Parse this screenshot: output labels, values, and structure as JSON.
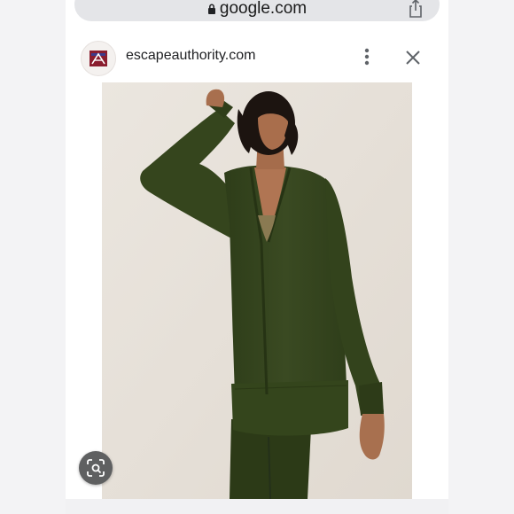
{
  "browser": {
    "url": "google.com"
  },
  "site_header": {
    "site_name": "escapeauthority.com"
  },
  "icons": {
    "lock": "lock-icon",
    "share": "share-icon",
    "menu": "more-vert-icon",
    "close": "close-icon",
    "lens": "google-lens-icon"
  },
  "colors": {
    "url_bar": "#e4e5e8",
    "garment": "#37471f",
    "favicon_accent": "#8a1d2f"
  }
}
